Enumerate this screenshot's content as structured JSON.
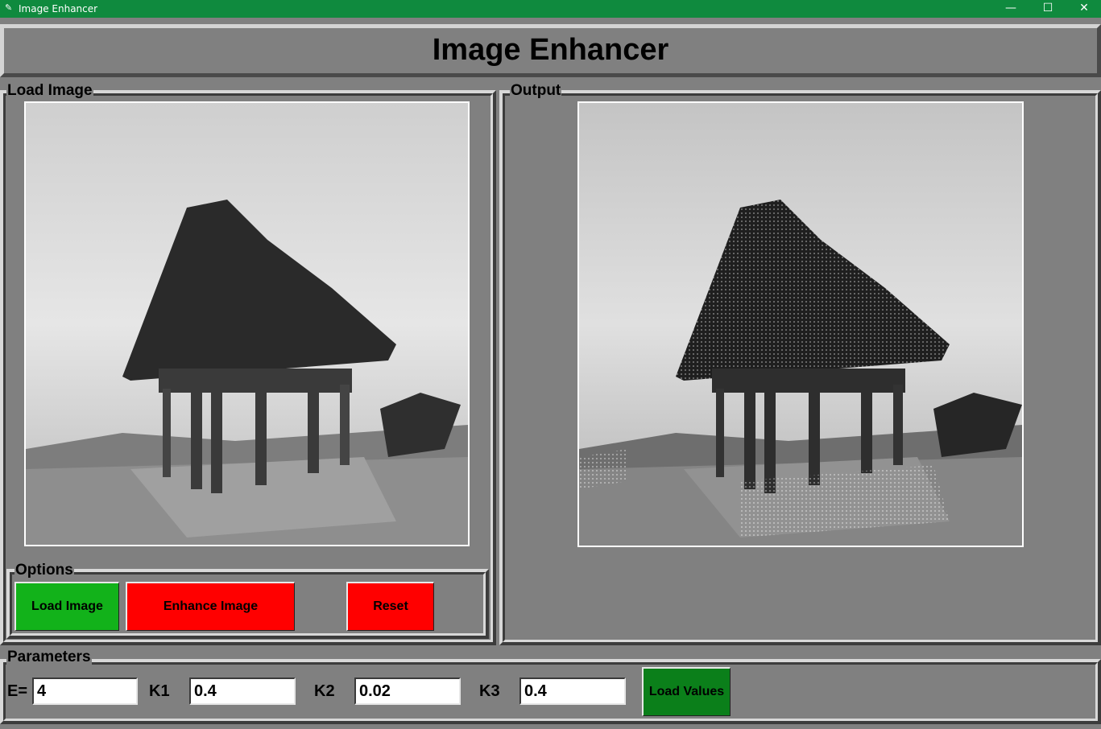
{
  "window": {
    "title": "Image Enhancer",
    "controls": {
      "minimize": "—",
      "maximize": "☐",
      "close": "✕"
    }
  },
  "header": {
    "title": "Image Enhancer"
  },
  "load_panel": {
    "legend": "Load Image"
  },
  "output_panel": {
    "legend": "Output"
  },
  "options": {
    "legend": "Options",
    "load_button": "Load Image",
    "enhance_button": "Enhance Image",
    "reset_button": "Reset"
  },
  "parameters": {
    "legend": "Parameters",
    "e_label": "E=",
    "e_value": "4",
    "k1_label": "K1",
    "k1_value": "0.4",
    "k2_label": "K2",
    "k2_value": "0.02",
    "k3_label": "K3",
    "k3_value": "0.4",
    "load_values_button": "Load Values"
  },
  "colors": {
    "titlebar": "#0f8a3e",
    "background": "#808080",
    "green_button": "#12b21a",
    "red_button": "#ff0000",
    "dark_green_button": "#0b7f1a"
  }
}
